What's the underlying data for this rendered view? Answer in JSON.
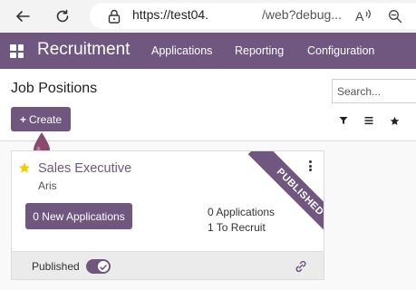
{
  "browser": {
    "url_host": "https://test04.",
    "url_path": "/web?debug...",
    "icons": [
      "back-arrow-icon",
      "reload-icon",
      "lock-icon",
      "read-aloud-icon",
      "zoom-icon"
    ]
  },
  "nav": {
    "app_name": "Recruitment",
    "menu": [
      "Applications",
      "Reporting",
      "Configuration"
    ]
  },
  "control": {
    "title": "Job Positions",
    "create_label": "Create",
    "search_placeholder": "Search...",
    "view_icons": [
      "filter-icon",
      "group-by-icon",
      "favorites-icon"
    ]
  },
  "card": {
    "job_title": "Sales Executive",
    "company": "Aris",
    "new_applications_label": "0 New Applications",
    "applications_label": "0 Applications",
    "to_recruit_label": "1 To Recruit",
    "ribbon": "PUBLISHED",
    "published_label": "Published",
    "published": true,
    "favorite": true
  },
  "colors": {
    "brand": "#6f577f",
    "star": "#f3cc00"
  }
}
